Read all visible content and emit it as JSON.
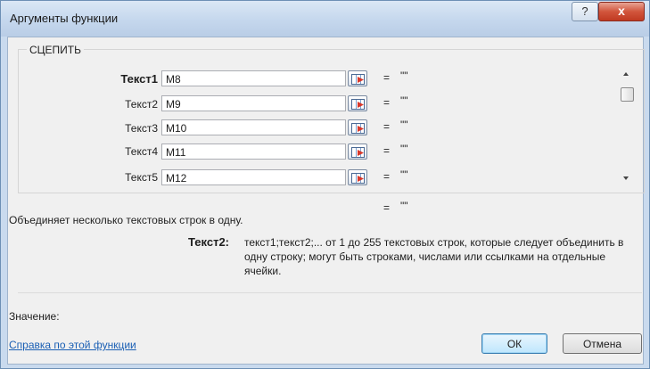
{
  "window": {
    "title": "Аргументы функции",
    "help_icon": "?",
    "close_icon": "x"
  },
  "function": {
    "name": "СЦЕПИТЬ",
    "args": [
      {
        "label": "Текст1",
        "value": "M8",
        "result": "\"\""
      },
      {
        "label": "Текст2",
        "value": "M9",
        "result": "\"\""
      },
      {
        "label": "Текст3",
        "value": "M10",
        "result": "\"\""
      },
      {
        "label": "Текст4",
        "value": "M11",
        "result": "\"\""
      },
      {
        "label": "Текст5",
        "value": "M12",
        "result": "\"\""
      }
    ],
    "total_result": "\"\"",
    "eq_sign": "=",
    "description": "Объединяет несколько текстовых строк в одну.",
    "arg_help_name": "Текст2:",
    "arg_help_text": "текст1;текст2;... от 1 до 255 текстовых строк, которые следует объединить в одну строку; могут быть строками, числами или ссылками на отдельные ячейки."
  },
  "footer": {
    "value_label": "Значение:",
    "help_link": "Справка по этой функции",
    "ok_label": "ОК",
    "cancel_label": "Отмена"
  },
  "icons": {
    "ref_button": "collapse-dialog-icon"
  }
}
